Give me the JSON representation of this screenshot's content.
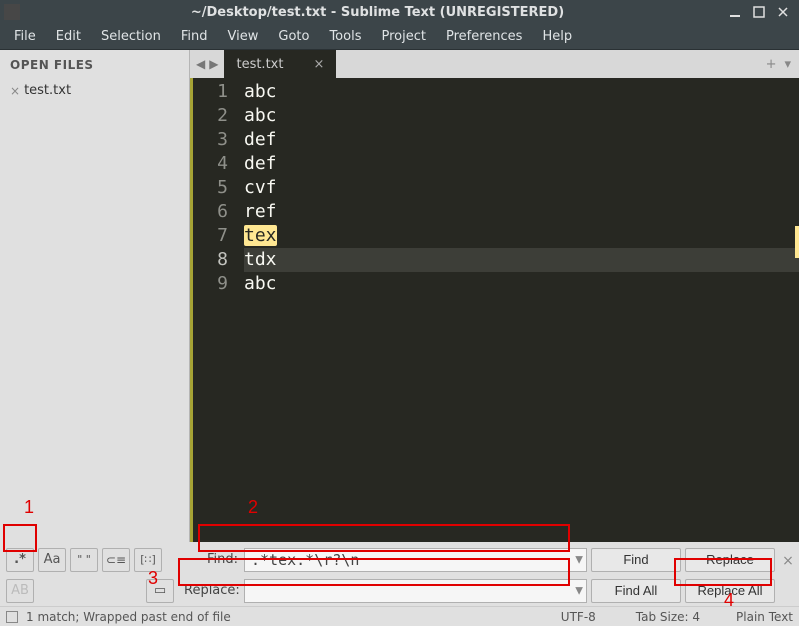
{
  "titlebar": {
    "title": "~/Desktop/test.txt - Sublime Text (UNREGISTERED)"
  },
  "menubar": {
    "items": [
      "File",
      "Edit",
      "Selection",
      "Find",
      "View",
      "Goto",
      "Tools",
      "Project",
      "Preferences",
      "Help"
    ]
  },
  "sidebar": {
    "header": "OPEN FILES",
    "items": [
      {
        "label": "test.txt"
      }
    ]
  },
  "tabs": {
    "active": {
      "label": "test.txt"
    }
  },
  "editor": {
    "lines": [
      {
        "n": 1,
        "text": "abc"
      },
      {
        "n": 2,
        "text": "abc"
      },
      {
        "n": 3,
        "text": "def"
      },
      {
        "n": 4,
        "text": "def"
      },
      {
        "n": 5,
        "text": "cvf"
      },
      {
        "n": 6,
        "text": "ref"
      },
      {
        "n": 7,
        "text": "tex",
        "match": true
      },
      {
        "n": 8,
        "text": "tdx",
        "cursor": true
      },
      {
        "n": 9,
        "text": "abc"
      }
    ]
  },
  "panel": {
    "toggles_row1": [
      ".*",
      "Aa",
      "\" \"",
      "⊂≡",
      "[∷]"
    ],
    "toggles_row2": [
      "AB",
      "▭"
    ],
    "find_label": "Find:",
    "find_value": ".*tex.*\\r?\\n",
    "replace_label": "Replace:",
    "replace_value": "",
    "btn_find": "Find",
    "btn_replace": "Replace",
    "btn_find_all": "Find All",
    "btn_replace_all": "Replace All"
  },
  "statusbar": {
    "msg": "1 match; Wrapped past end of file",
    "enc": "UTF-8",
    "tabsize": "Tab Size: 4",
    "syntax": "Plain Text"
  },
  "annotations": {
    "n1": "1",
    "n2": "2",
    "n3": "3",
    "n4": "4"
  }
}
